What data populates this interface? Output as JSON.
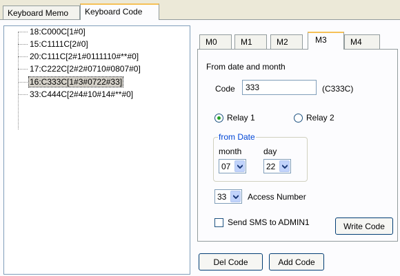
{
  "outer_tabs": [
    "Keyboard Memo",
    "Keyboard Code"
  ],
  "outer_active_tab": "Keyboard Code",
  "tree_items": [
    "18:C000C[1#0]",
    "15:C1111C[2#0]",
    "20:C111C[2#1#0111110#**#0]",
    "17:C222C[2#2#0710#0807#0]",
    "16:C333C[1#3#0722#33]",
    "33:C444C[2#4#10#14#**#0]"
  ],
  "tree_selected": "16:C333C[1#3#0722#33]",
  "inner_tabs": [
    "M0",
    "M1",
    "M2",
    "M3",
    "M4"
  ],
  "inner_active_tab": "M3",
  "form": {
    "heading": "From date and month",
    "code_label": "Code",
    "code_value": "333",
    "code_hint": "(C333C)",
    "relay1_label": "Relay 1",
    "relay2_label": "Relay 2",
    "relay_selected": "Relay 1",
    "group_title": "from Date",
    "month_label": "month",
    "day_label": "day",
    "month_value": "07",
    "day_value": "22",
    "access_value": "33",
    "access_label": "Access Number",
    "sms_label": "Send SMS to ADMIN1",
    "sms_checked": false,
    "write_button": "Write Code"
  },
  "buttons": {
    "del_code": "Del Code",
    "add_code": "Add Code"
  },
  "colors": {
    "tab_accent": "#f5c056",
    "group_title": "#0046d5",
    "radio_dot": "#21a121"
  }
}
